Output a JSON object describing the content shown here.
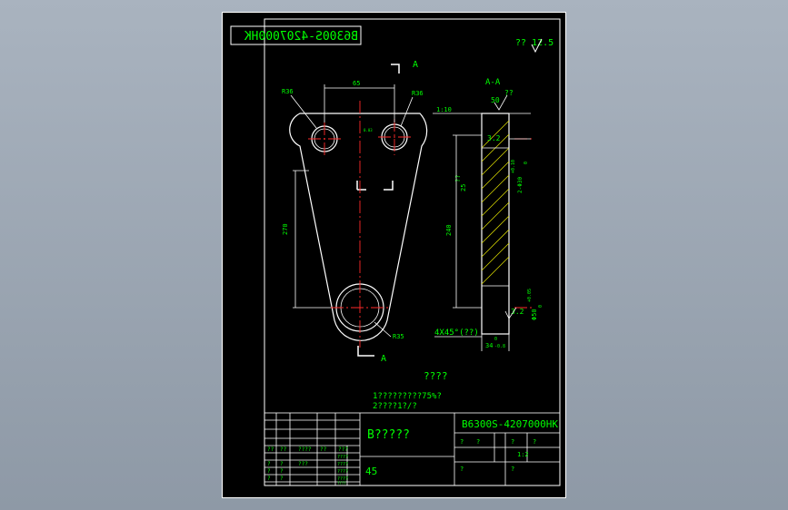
{
  "drawing": {
    "code_mirrored": "B6300S-4207000HK",
    "roughness_corner": "?? 12.5",
    "view_label_A_top": "A",
    "view_label_A_bottom": "A",
    "section_title": "A-A",
    "dim_65": "65",
    "dim_270": "270",
    "dim_240": "240",
    "dim_r36_left": "R36",
    "dim_r36_right": "R36",
    "dim_r35_bottom": "R35",
    "dim_small_center": "0.03",
    "dim_1_10": "1:10",
    "rough_50": "50",
    "rough_qq": "??",
    "rough_3_2_top": "3.2",
    "rough_25": "25",
    "rough_qq_side": "??",
    "rough_3_2_bottom": "3.2",
    "dim_plus_top": "+0.10",
    "dim_zero_top": "0",
    "dim_side_top": "2-Φ30",
    "dim_plus_bottom": "+0.05",
    "dim_zero_bottom": "0",
    "dim_side_bottom": "Φ50",
    "dim_34": "34",
    "dim_34_tol": "-0.8",
    "dim_34_zero": "0",
    "chamfer_note": "4X45°(??)",
    "notes_title": "????",
    "note_1": "1?????????75%?",
    "note_2": "2????1?/?"
  },
  "title_block": {
    "part_name": "B?????",
    "drawing_no": "B6300S-4207000HK",
    "material": "45",
    "scale": "1:2",
    "q": "?",
    "qq": "??",
    "qqq": "???",
    "qqqq": "????",
    "stamp1": "????",
    "stamp2": "????",
    "stamp3": "????",
    "stamp4": "????",
    "stamp5": "????"
  }
}
